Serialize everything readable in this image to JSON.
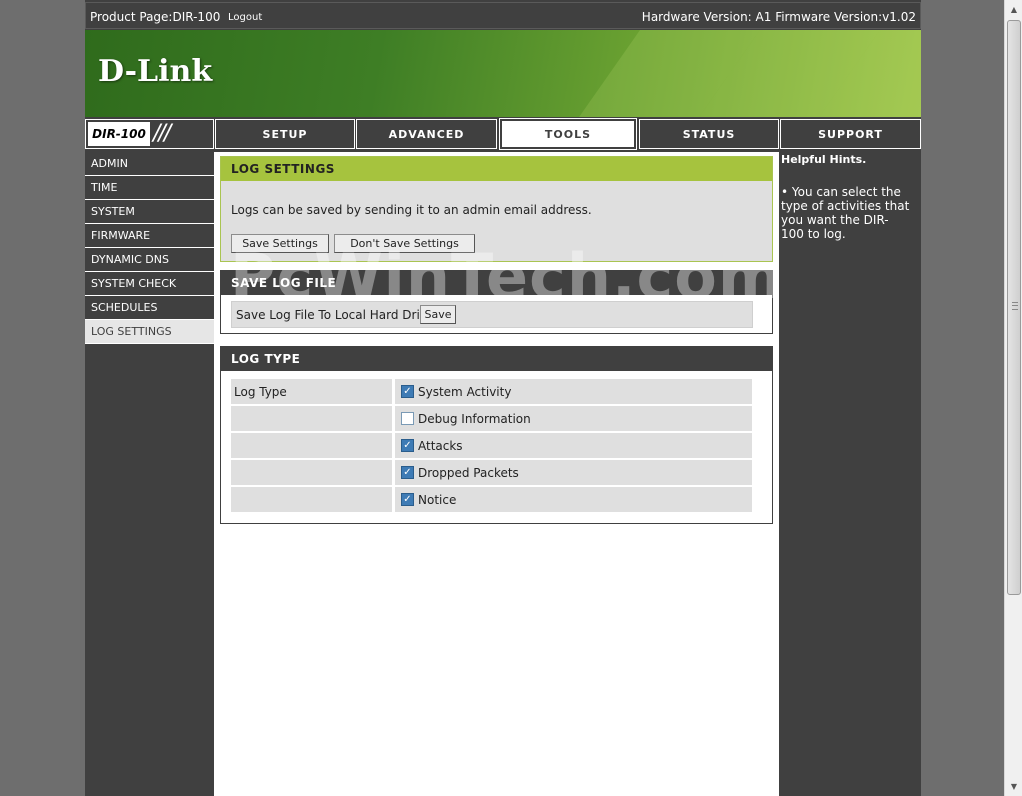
{
  "topbar": {
    "product": "Product Page:DIR-100",
    "logout": "Logout",
    "versions": "Hardware Version: A1   Firmware Version:v1.02"
  },
  "banner": {
    "logo": "D-Link"
  },
  "model": {
    "label": "DIR-100",
    "slashes": "///"
  },
  "tabs": [
    {
      "label": "SETUP",
      "active": false
    },
    {
      "label": "ADVANCED",
      "active": false
    },
    {
      "label": "TOOLS",
      "active": true
    },
    {
      "label": "STATUS",
      "active": false
    },
    {
      "label": "SUPPORT",
      "active": false
    }
  ],
  "sidebar": {
    "items": [
      {
        "label": "ADMIN",
        "active": false
      },
      {
        "label": "TIME",
        "active": false
      },
      {
        "label": "SYSTEM",
        "active": false
      },
      {
        "label": "FIRMWARE",
        "active": false
      },
      {
        "label": "DYNAMIC DNS",
        "active": false
      },
      {
        "label": "SYSTEM CHECK",
        "active": false
      },
      {
        "label": "SCHEDULES",
        "active": false
      },
      {
        "label": "LOG SETTINGS",
        "active": true
      }
    ]
  },
  "log_settings": {
    "title": "LOG SETTINGS",
    "description": "Logs can be saved by sending it to an admin email address.",
    "save_button": "Save Settings",
    "dont_save_button": "Don't Save Settings"
  },
  "save_log_file": {
    "title": "SAVE LOG FILE",
    "label": "Save Log File To Local Hard Drive",
    "save_button": "Save"
  },
  "log_type": {
    "title": "LOG TYPE",
    "label": "Log Type",
    "options": [
      {
        "label": "System Activity",
        "checked": true
      },
      {
        "label": "Debug Information",
        "checked": false
      },
      {
        "label": "Attacks",
        "checked": true
      },
      {
        "label": "Dropped Packets",
        "checked": true
      },
      {
        "label": "Notice",
        "checked": true
      }
    ]
  },
  "hints": {
    "title": "Helpful Hints.",
    "text": "•  You can select the type of activities that you want the DIR-100 to log."
  },
  "watermark": "PcWinTech.com",
  "colors": {
    "dark": "#404040",
    "green_header": "#a6c33e",
    "checkbox": "#3e7bb5"
  }
}
